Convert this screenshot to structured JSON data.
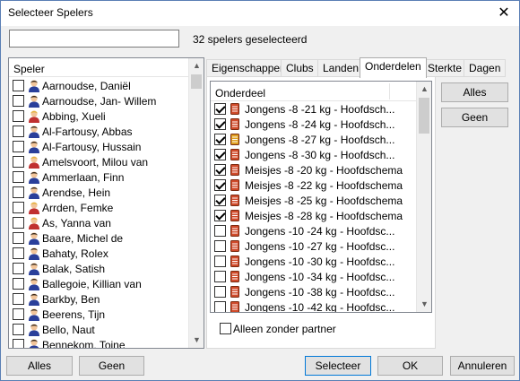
{
  "window": {
    "title": "Selecteer Spelers",
    "close_glyph": "✕"
  },
  "search": {
    "value": ""
  },
  "status": {
    "count_text": "32 spelers geselecteerd"
  },
  "players": {
    "header": "Speler",
    "items": [
      {
        "name": "Aarnoudse, Daniël",
        "gender": "m"
      },
      {
        "name": "Aarnoudse, Jan- Willem",
        "gender": "m"
      },
      {
        "name": "Abbing, Xueli",
        "gender": "f"
      },
      {
        "name": "Al-Fartousy, Abbas",
        "gender": "m"
      },
      {
        "name": "Al-Fartousy, Hussain",
        "gender": "m"
      },
      {
        "name": "Amelsvoort, Milou van",
        "gender": "f"
      },
      {
        "name": "Ammerlaan, Finn",
        "gender": "m"
      },
      {
        "name": "Arendse, Hein",
        "gender": "m"
      },
      {
        "name": "Arrden, Femke",
        "gender": "f"
      },
      {
        "name": "As, Yanna van",
        "gender": "f"
      },
      {
        "name": "Baare, Michel de",
        "gender": "m"
      },
      {
        "name": "Bahaty, Rolex",
        "gender": "m"
      },
      {
        "name": "Balak, Satish",
        "gender": "m"
      },
      {
        "name": "Ballegoie, Killian van",
        "gender": "m"
      },
      {
        "name": "Barkby, Ben",
        "gender": "m"
      },
      {
        "name": "Beerens, Tijn",
        "gender": "m"
      },
      {
        "name": "Bello, Naut",
        "gender": "m"
      },
      {
        "name": "Bennekom, Toine",
        "gender": "m"
      }
    ]
  },
  "tabs": [
    {
      "label": "Eigenschappen",
      "active": false
    },
    {
      "label": "Clubs",
      "active": false
    },
    {
      "label": "Landen",
      "active": false
    },
    {
      "label": "Onderdelen",
      "active": true
    },
    {
      "label": "Sterkte",
      "active": false
    },
    {
      "label": "Dagen",
      "active": false
    }
  ],
  "events": {
    "header": "Onderdeel",
    "items": [
      {
        "name": "Jongens -8 -21 kg - Hoofdsch...",
        "checked": true,
        "icon_color": "#d04a2a"
      },
      {
        "name": "Jongens -8 -24 kg - Hoofdsch...",
        "checked": true,
        "icon_color": "#d04a2a"
      },
      {
        "name": "Jongens -8 -27 kg - Hoofdsch...",
        "checked": true,
        "icon_color": "#e0a020"
      },
      {
        "name": "Jongens -8 -30 kg - Hoofdsch...",
        "checked": true,
        "icon_color": "#d04a2a"
      },
      {
        "name": "Meisjes -8 -20 kg - Hoofdschema",
        "checked": true,
        "icon_color": "#d04a2a"
      },
      {
        "name": "Meisjes -8 -22 kg - Hoofdschema",
        "checked": true,
        "icon_color": "#d04a2a"
      },
      {
        "name": "Meisjes -8 -25 kg - Hoofdschema",
        "checked": true,
        "icon_color": "#d04a2a"
      },
      {
        "name": "Meisjes -8 -28 kg - Hoofdschema",
        "checked": true,
        "icon_color": "#d04a2a"
      },
      {
        "name": "Jongens -10 -24 kg - Hoofdsc...",
        "checked": false,
        "icon_color": "#d04a2a"
      },
      {
        "name": "Jongens -10 -27 kg - Hoofdsc...",
        "checked": false,
        "icon_color": "#d04a2a"
      },
      {
        "name": "Jongens -10 -30 kg - Hoofdsc...",
        "checked": false,
        "icon_color": "#d04a2a"
      },
      {
        "name": "Jongens -10 -34 kg - Hoofdsc...",
        "checked": false,
        "icon_color": "#d04a2a"
      },
      {
        "name": "Jongens -10 -38 kg - Hoofdsc...",
        "checked": false,
        "icon_color": "#d04a2a"
      },
      {
        "name": "Jongens -10 -42 kg - Hoofdsc...",
        "checked": false,
        "icon_color": "#d04a2a"
      }
    ],
    "partner_label": "Alleen zonder partner"
  },
  "buttons": {
    "events_all": "Alles",
    "events_none": "Geen",
    "players_all": "Alles",
    "players_none": "Geen",
    "select": "Selecteer",
    "ok": "OK",
    "cancel": "Annuleren"
  },
  "colors": {
    "male_icon": "#2a3f9a",
    "female_icon": "#c03030",
    "skin": "#f2c59a",
    "hair_female": "#e3b23c",
    "hair_male": "#3a2a1a"
  }
}
